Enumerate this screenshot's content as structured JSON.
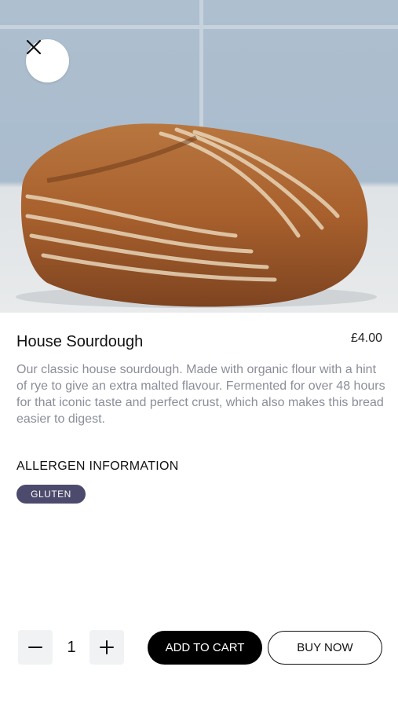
{
  "product": {
    "name": "House Sourdough",
    "price": "£4.00",
    "description": "Our classic house sourdough. Made with organic flour with a hint of rye to give an extra malted flavour. Fermented for over 48 hours for that iconic taste and perfect crust, which also makes this bread easier to digest.",
    "image_icon": "sourdough-loaf-photo"
  },
  "allergens": {
    "heading": "ALLERGEN INFORMATION",
    "items": [
      "GLUTEN"
    ]
  },
  "cart": {
    "quantity": "1",
    "add_to_cart_label": "ADD TO CART",
    "buy_now_label": "BUY NOW"
  },
  "icons": {
    "close": "close-icon",
    "minus": "minus-icon",
    "plus": "plus-icon"
  },
  "colors": {
    "badge": "#4d4b6d",
    "primary_button": "#000000",
    "description_text": "#8b8e99"
  }
}
